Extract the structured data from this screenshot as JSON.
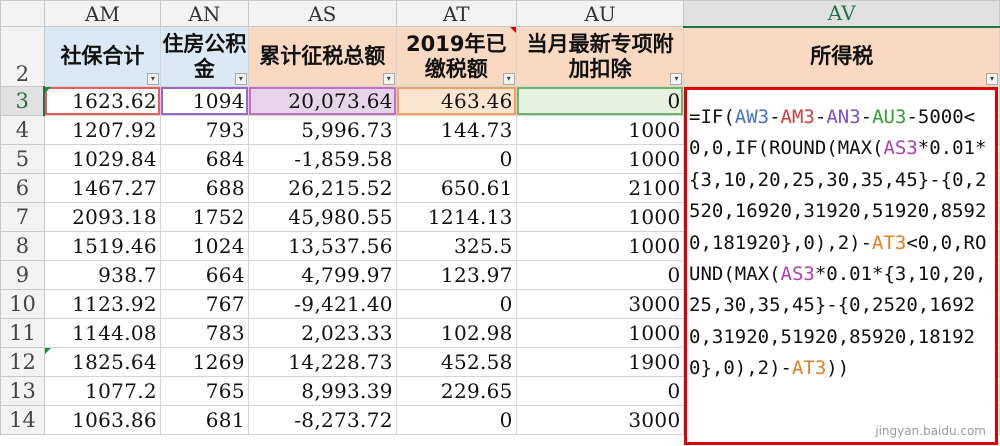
{
  "columns": [
    "AM",
    "AN",
    "AS",
    "AT",
    "AU",
    "AV"
  ],
  "headers": {
    "row_number": "2",
    "AM": "社保合计",
    "AN": "住房公积金",
    "AS": "累计征税总额",
    "AT": "2019年已缴税额",
    "AU": "当月最新专项附加扣除",
    "AV": "所得税"
  },
  "rows": [
    {
      "n": "3",
      "am": "1623.62",
      "an": "1094",
      "as": "20,073.64",
      "at": "463.46",
      "au": "0"
    },
    {
      "n": "4",
      "am": "1207.92",
      "an": "793",
      "as": "5,996.73",
      "at": "144.73",
      "au": "1000"
    },
    {
      "n": "5",
      "am": "1029.84",
      "an": "684",
      "as": "-1,859.58",
      "at": "0",
      "au": "1000"
    },
    {
      "n": "6",
      "am": "1467.27",
      "an": "688",
      "as": "26,215.52",
      "at": "650.61",
      "au": "2100"
    },
    {
      "n": "7",
      "am": "2093.18",
      "an": "1752",
      "as": "45,980.55",
      "at": "1214.13",
      "au": "1000"
    },
    {
      "n": "8",
      "am": "1519.46",
      "an": "1024",
      "as": "13,537.56",
      "at": "325.5",
      "au": "1000"
    },
    {
      "n": "9",
      "am": "938.7",
      "an": "664",
      "as": "4,799.97",
      "at": "123.97",
      "au": "0"
    },
    {
      "n": "10",
      "am": "1123.92",
      "an": "767",
      "as": "-9,421.40",
      "at": "0",
      "au": "3000"
    },
    {
      "n": "11",
      "am": "1144.08",
      "an": "783",
      "as": "2,023.33",
      "at": "102.98",
      "au": "1000"
    },
    {
      "n": "12",
      "am": "1825.64",
      "an": "1269",
      "as": "14,228.73",
      "at": "452.58",
      "au": "1900"
    },
    {
      "n": "13",
      "am": "1077.2",
      "an": "765",
      "as": "8,993.39",
      "at": "229.65",
      "au": "0"
    },
    {
      "n": "14",
      "am": "1063.86",
      "an": "681",
      "as": "-8,273.72",
      "at": "0",
      "au": "3000"
    }
  ],
  "formula_segments": [
    {
      "t": "=IF(",
      "c": ""
    },
    {
      "t": "AW3",
      "c": "f-blue"
    },
    {
      "t": "-",
      "c": ""
    },
    {
      "t": "AM3",
      "c": "f-red"
    },
    {
      "t": "-",
      "c": ""
    },
    {
      "t": "AN3",
      "c": "f-purple"
    },
    {
      "t": "-",
      "c": ""
    },
    {
      "t": "AU3",
      "c": "f-green"
    },
    {
      "t": "-5000<0,0,IF(ROUND(MAX(",
      "c": ""
    },
    {
      "t": "AS3",
      "c": "f-mag"
    },
    {
      "t": "*0.01*{3,10,20,25,30,35,45}-{0,2520,16920,31920,51920,85920,181920},0),2)-",
      "c": ""
    },
    {
      "t": "AT3",
      "c": "f-orange"
    },
    {
      "t": "<0,0,ROUND(MAX(",
      "c": ""
    },
    {
      "t": "AS3",
      "c": "f-mag"
    },
    {
      "t": "*0.01*{3,10,20,25,30,35,45}-{0,2520,16920,31920,51920,85920,181920},0),2)-",
      "c": ""
    },
    {
      "t": "AT3",
      "c": "f-orange"
    },
    {
      "t": "))",
      "c": ""
    }
  ],
  "watermark": "jingyan.baidu.com",
  "filter_glyph": "▾"
}
